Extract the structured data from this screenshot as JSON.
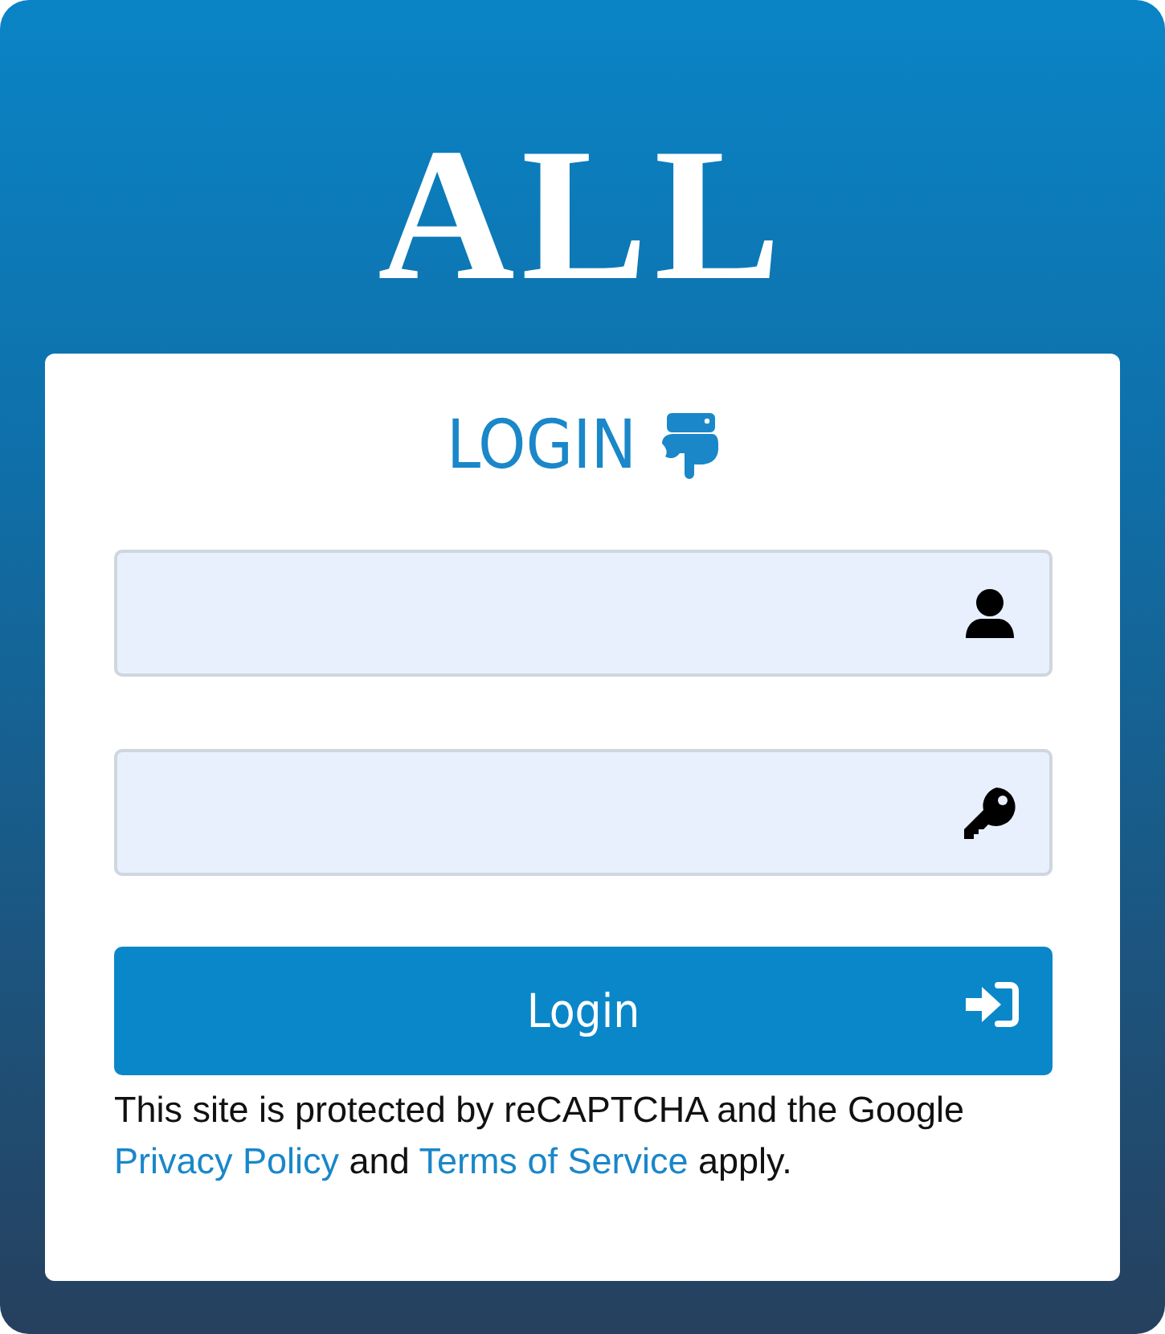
{
  "logo": {
    "text": "ALL"
  },
  "login": {
    "heading": "LOGIN",
    "fields": [
      {
        "kind": "user"
      },
      {
        "kind": "key"
      }
    ],
    "button": {
      "label": "Login"
    },
    "notice": [
      {
        "kind": "text",
        "text": "This site is protected by reCAPTCHA and the Google "
      },
      {
        "kind": "link",
        "text": "Privacy Policy"
      },
      {
        "kind": "text",
        "text": " and "
      },
      {
        "kind": "link",
        "text": "Terms of Service"
      },
      {
        "kind": "text",
        "text": " apply."
      }
    ]
  }
}
